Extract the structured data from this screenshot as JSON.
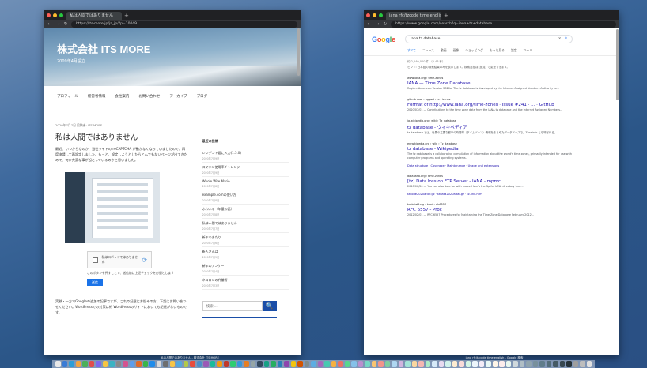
{
  "left_window": {
    "tab_title": "私は人間ではありません",
    "url": "https://its-more.jp/ja_jp/?p=10049",
    "site_title": "株式会社 ITS MORE",
    "site_subtitle": "2009年4月設立",
    "menu": [
      "プロフィール",
      "経営者情報",
      "会社案内",
      "お問い合わせ",
      "アーカイブ",
      "ブログ"
    ],
    "post_meta": "2020年7月7日 投稿者: ITS MORE",
    "post_title": "私は人間ではありません",
    "paragraph1": "最近、いつからなのか、当社ワイトの reCAPTCHA が動かなくなっていましたので、再度申請して再設定しました。もっと、設定しようとしたらとんでもないページが出てきたので、何か大変な事が起こっているのかと思いました。",
    "captcha_text": "私はロボットではありません",
    "captcha_note": "このボタンを押すことで、送信前に上記チェックを必須とします",
    "captcha_button": "送信",
    "paragraph2": "実験・一方でGoogleの追加の記事ですが、これの記載にお悩みの方、下記にお問い合わせください。WordPressでの対策は約 WordPressのサイトにおいても記述がないものです。",
    "sidebar_heading": "最近の投稿",
    "sidebar_items": [
      {
        "title": "レジデント届に入力(1.5.0)",
        "date": "2020年7月9日"
      },
      {
        "title": "スマホン使用率チャレンジ",
        "date": "2020年7月9日"
      },
      {
        "title": "Whole Wife Mario",
        "date": "2020年7月8日"
      },
      {
        "title": "example.comの使い方",
        "date": "2020年7月8日"
      },
      {
        "title": "ふわぷる（年量の話）",
        "date": "2020年7月8日"
      },
      {
        "title": "私は人間ではありません",
        "date": "2020年7月7日"
      },
      {
        "title": "新年のあたり",
        "date": "2020年7月6日"
      },
      {
        "title": "新人さんは",
        "date": "2020年7月5日"
      },
      {
        "title": "新年のアンケー",
        "date": "2020年7月4日"
      },
      {
        "title": "ネコロンの弁論術",
        "date": "2020年7月3日"
      }
    ],
    "search_placeholder": "検索 ...",
    "search_button": "🔍"
  },
  "right_window": {
    "tab_title": "iana rfc/tzcode time.english - Google 検索",
    "url": "https://www.google.com/search?q=iana+tz+database",
    "logo_letters": [
      "G",
      "o",
      "o",
      "g",
      "l",
      "e"
    ],
    "logo_colors": [
      "#4285f4",
      "#ea4335",
      "#fbbc05",
      "#4285f4",
      "#34a853",
      "#ea4335"
    ],
    "query": "iana tz database",
    "tabs": [
      "すべて",
      "ニュース",
      "動画",
      "画像",
      "ショッピング",
      "もっと見る",
      "設定",
      "ツール"
    ],
    "stats": "約 2,240,000 件 （0.46 秒）",
    "note": "ヒント: 日本語の検索結果のみを表示します。検索言語は [設定] で変更できます。",
    "results": [
      {
        "url": "www.iana.org › time-zones",
        "title": "IANA — Time Zone Database",
        "snippet": "Region: Americas. Version 2020a. The tz database is developed by the Internet Assigned Numbers Authority to..."
      },
      {
        "url": "github.com › eggert › tz › issues",
        "title": "Format of http://www.iana.org/time-zones · Issue #241 · ... · GitHub",
        "snippet": "2020/07/01 — Contributions to the time zone data from the IANA tz database and the Internet Assigned Numbers..."
      },
      {
        "url": "ja.wikipedia.org › wiki › Tz_database",
        "title": "tz database - ウィキペディア",
        "snippet": "tz database とは、世界の主要な都市の時間帯（タイムゾーン）情報をまとめたデータベースで、Zoneinfo とも呼ばれる。"
      },
      {
        "url": "en.wikipedia.org › wiki › Tz_database",
        "title": "tz database - Wikipedia",
        "snippet": "The tz database is a collaborative compilation of information about the world's time zones, primarily intended for use with computer programs and operating systems.",
        "extra": "Data structure · Coverage · Maintenance · Usage and extensions"
      },
      {
        "url": "data.iana.org › time-zones",
        "title": "[tz] Data loss on FTP Server - IANA - mpmc",
        "snippet": "2020/06/20 — You can also do a tar with maps. Here's the ftp for IANA directory tree...",
        "extra": "tzcode2020a.tar.gz · tzdata2020a.tar.gz · tz-link.htm"
      },
      {
        "url": "tools.ietf.org › html › rfc6557",
        "title": "RFC 6557 - Proc",
        "snippet": "2012/02/01 — RFC 6557 Procedures for Maintaining the Time Zone Database February 2012..."
      }
    ]
  },
  "dock_labels": {
    "left": "私は人間ではありません - 株式会社 ITS MORE",
    "right": "iana rfc/tzcode time.english - Google 検索"
  },
  "dock_icon_colors": [
    "#e8e8e8",
    "#3a7bd5",
    "#2c9ed8",
    "#f2a541",
    "#4db05a",
    "#e04d4d",
    "#7b68ee",
    "#f5c542",
    "#3bb3c3",
    "#8a8a8a",
    "#d35490",
    "#5c9ded",
    "#e06b2a",
    "#39b54a",
    "#1f8ceb",
    "#d9d9d9",
    "#6e6e6e",
    "#f7c548",
    "#52a8e0",
    "#b2c94a",
    "#e84c3d",
    "#4c8ec9",
    "#9b59b6",
    "#1abc9c",
    "#f39c12",
    "#c0392b",
    "#2ecc71",
    "#3498db",
    "#e67e22",
    "#95a5a6",
    "#34495e",
    "#16a085",
    "#27ae60",
    "#2980b9",
    "#8e44ad",
    "#f1c40f",
    "#d35400",
    "#7f8c8d",
    "#5dade2",
    "#a569bd",
    "#48c9b0",
    "#f5b041",
    "#ec7063",
    "#58d68d",
    "#85c1e9",
    "#bb8fce",
    "#76d7c4",
    "#f8c471",
    "#f1948a",
    "#7dcea0",
    "#aed6f1",
    "#d2b4de",
    "#a3e4d7",
    "#fad7a0",
    "#f5b7b1",
    "#abebc6",
    "#d6eaf8",
    "#e8daef",
    "#d1f2eb",
    "#fdebd0",
    "#fadbd8",
    "#d5f5e3",
    "#ebf5fb",
    "#f4ecf7",
    "#e8f8f5",
    "#fef5e7",
    "#fdedec",
    "#e9f7ef",
    "#cfd8dc",
    "#b0bec5",
    "#90a4ae",
    "#78909c",
    "#607d8b",
    "#546e7a",
    "#455a64",
    "#37474f",
    "#263238",
    "#9e9e9e",
    "#bdbdbd",
    "#e0e0e0"
  ]
}
